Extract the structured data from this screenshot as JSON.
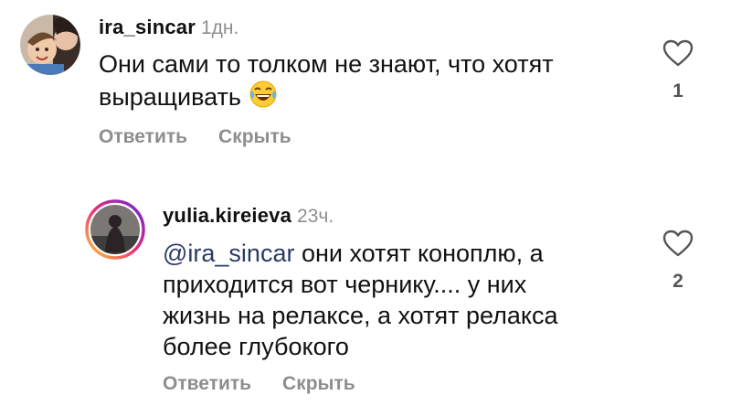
{
  "comments": [
    {
      "username": "ira_sincar",
      "time": "1дн.",
      "lines": [
        "Они сами то толком не знают, что хотят",
        "выращивать"
      ],
      "emoji": "rolling-on-floor-laughing",
      "likes": "1",
      "reply_label": "Ответить",
      "hide_label": "Скрыть"
    },
    {
      "username": "yulia.kireieva",
      "time": "23ч.",
      "mention": "@ira_sincar",
      "lines": [
        " они хотят коноплю, а",
        "приходится вот чернику.... у них",
        "жизнь на релаксе, а хотят релакса",
        "более глубокого"
      ],
      "likes": "2",
      "reply_label": "Ответить",
      "hide_label": "Скрыть"
    }
  ],
  "colors": {
    "text": "#111111",
    "muted": "#8e8e8e",
    "mention": "#2b3a67",
    "story_ring_start": "#f9ce34",
    "story_ring_mid": "#ee2a7b",
    "story_ring_end": "#6228d7"
  }
}
